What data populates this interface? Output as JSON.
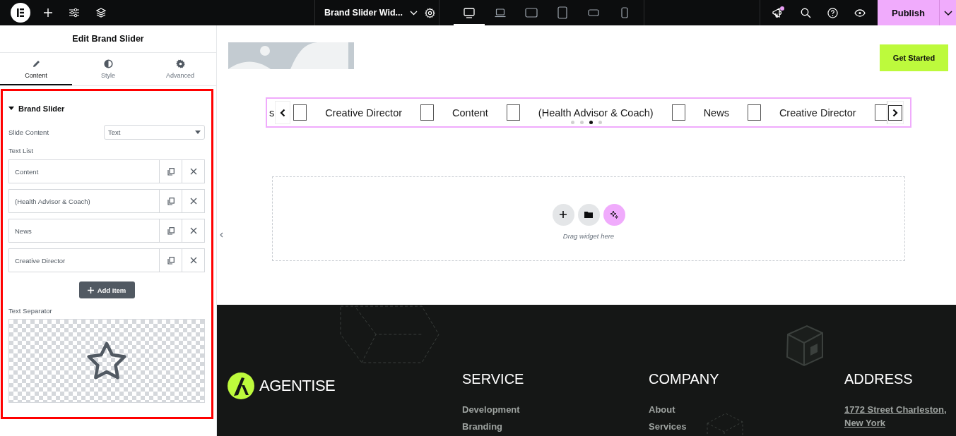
{
  "topbar": {
    "document_title": "Brand Slider Wid...",
    "devices": [
      {
        "kind": "desktop",
        "selected": true
      },
      {
        "kind": "laptop",
        "selected": false
      },
      {
        "kind": "tablet-landscape",
        "selected": false
      },
      {
        "kind": "tablet",
        "selected": false
      },
      {
        "kind": "mobile-landscape",
        "selected": false
      },
      {
        "kind": "mobile",
        "selected": false
      }
    ],
    "notification": true,
    "publish": "Publish"
  },
  "panel": {
    "title": "Edit Brand Slider",
    "tabs": [
      {
        "kind": "content",
        "label": "Content",
        "selected": true
      },
      {
        "kind": "style",
        "label": "Style",
        "selected": false
      },
      {
        "kind": "advanced",
        "label": "Advanced",
        "selected": false
      }
    ],
    "section": {
      "title": "Brand Slider",
      "expanded": true
    },
    "slide_content": {
      "label": "Slide Content",
      "value": "Text"
    },
    "text_list": {
      "label": "Text List",
      "items": [
        "Content",
        "(Health Advisor & Coach)",
        "News",
        "Creative Director"
      ]
    },
    "add_item": "Add Item",
    "separator_label": "Text Separator"
  },
  "canvas": {
    "get_started": "Get Started",
    "slider": {
      "items": [
        "s",
        "Creative Director",
        "Content",
        "(Health Advisor & Coach)",
        "News",
        "Creative Director"
      ],
      "dots": [
        {
          "selected": false
        },
        {
          "selected": false
        },
        {
          "selected": true
        },
        {
          "selected": false
        }
      ]
    },
    "drop_hint": "Drag widget here"
  },
  "footer": {
    "brand": "AGENTISE",
    "columns": [
      {
        "kind": "links",
        "heading": "SERVICE",
        "links": [
          "Development",
          "Branding"
        ]
      },
      {
        "kind": "links",
        "heading": "COMPANY",
        "links": [
          "About",
          "Services"
        ]
      },
      {
        "kind": "address",
        "heading": "ADDRESS",
        "links": [
          "1772 Street Charleston,",
          "New York"
        ]
      }
    ]
  }
}
